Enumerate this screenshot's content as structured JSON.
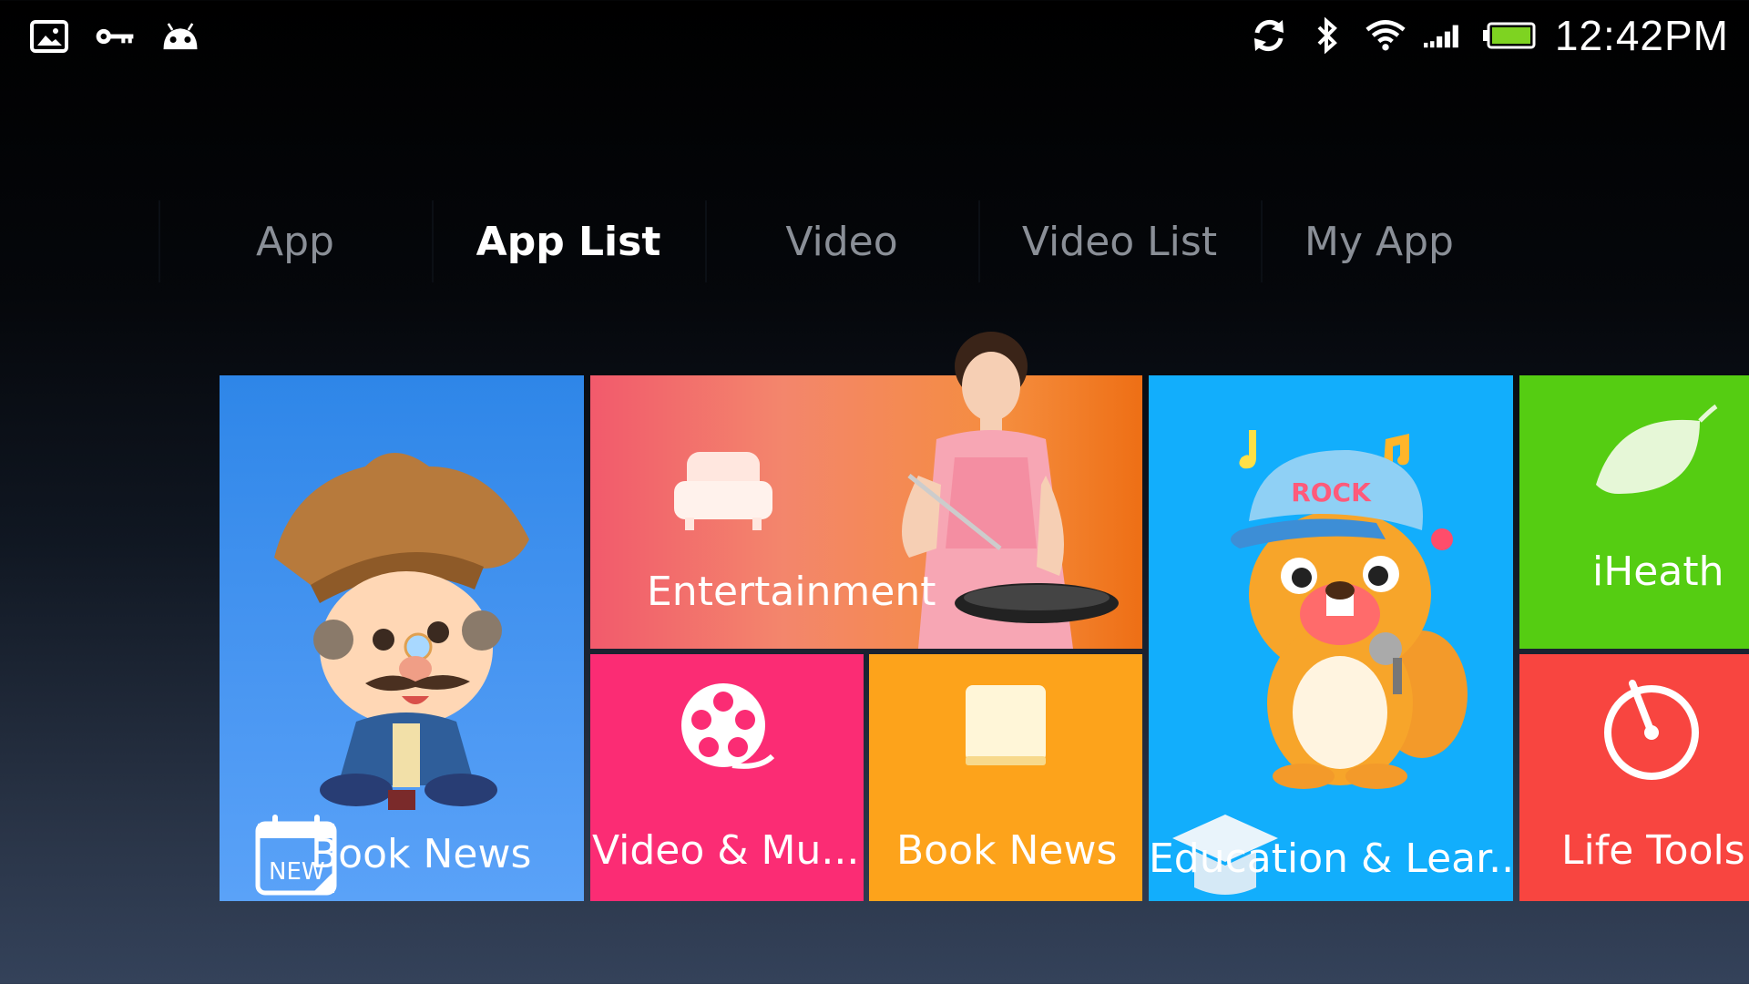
{
  "status_bar": {
    "left_icons": [
      "gallery-icon",
      "key-icon",
      "android-icon"
    ],
    "right_icons": [
      "sync-icon",
      "bluetooth-icon",
      "wifi-icon",
      "signal-icon",
      "battery-icon"
    ],
    "time": "12:42PM",
    "battery_color": "#7ed321"
  },
  "tabs": [
    {
      "label": "App",
      "active": false
    },
    {
      "label": "App List",
      "active": true
    },
    {
      "label": "Video",
      "active": false
    },
    {
      "label": "Video List",
      "active": false
    },
    {
      "label": "My App",
      "active": false
    }
  ],
  "tiles": {
    "book_news_large": {
      "label": "Book News",
      "badge": "NEW",
      "color": "#3b8ff0"
    },
    "entertainment": {
      "label": "Entertainment",
      "color": "#f47a5a"
    },
    "video_music": {
      "label": "Video & Mu...",
      "color": "#fb2c74"
    },
    "book_news_small": {
      "label": "Book News",
      "color": "#fda31b"
    },
    "education": {
      "label": "Education & Lear...",
      "cap_text": "ROCK",
      "color": "#12aefc"
    },
    "iheath": {
      "label": "iHeath",
      "color": "#55cd12"
    },
    "life_tools": {
      "label": "Life Tools",
      "color": "#f84540"
    }
  }
}
